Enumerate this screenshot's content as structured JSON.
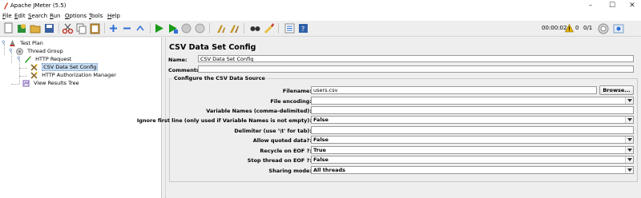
{
  "window": {
    "title": "Apache JMeter (5.5)",
    "minimize": "–",
    "maximize": "☐",
    "close": "✕"
  },
  "menu": [
    {
      "label": "File",
      "key": "F",
      "rest": "ile"
    },
    {
      "label": "Edit",
      "key": "E",
      "rest": "dit"
    },
    {
      "label": "Search",
      "key": "S",
      "rest": "earch"
    },
    {
      "label": "Run",
      "key": "R",
      "rest": "un"
    },
    {
      "label": "Options",
      "key": "O",
      "rest": "ptions"
    },
    {
      "label": "Tools",
      "key": "T",
      "rest": "ools"
    },
    {
      "label": "Help",
      "key": "H",
      "rest": "elp"
    }
  ],
  "toolbar": {
    "icons": [
      "new-icon",
      "templates-icon",
      "open-icon",
      "save-icon",
      "cut-icon",
      "copy-icon",
      "paste-icon",
      "expand-icon",
      "collapse-icon",
      "toggle-icon",
      "start-icon",
      "start-no-pauses-icon",
      "stop-icon",
      "shutdown-icon",
      "clear-icon",
      "clear-all-icon",
      "search-icon",
      "reset-search-icon",
      "function-helper-icon",
      "help-icon"
    ],
    "timer": "00:00:02",
    "warnings": "0",
    "threads": "0/1",
    "colors": {
      "run": "#1a9c1a",
      "accent": "#2f6fd6",
      "warning": "#e8b400"
    }
  },
  "tree": {
    "nodes": [
      {
        "label": "Test Plan",
        "icon": "test-plan-icon"
      },
      {
        "label": "Thread Group",
        "icon": "thread-group-icon"
      },
      {
        "label": "HTTP Request",
        "icon": "http-request-icon"
      },
      {
        "label": "CSV Data Set Config",
        "icon": "csv-config-icon"
      },
      {
        "label": "HTTP Authorization Manager",
        "icon": "auth-manager-icon"
      },
      {
        "label": "View Results Tree",
        "icon": "results-tree-icon"
      }
    ],
    "selected": "CSV Data Set Config"
  },
  "panel": {
    "title": "CSV Data Set Config",
    "name_label": "Name:",
    "name_value": "CSV Data Set Config",
    "comments_label": "Comments:",
    "comments_value": "",
    "group_title": "Configure the CSV Data Source",
    "filename_label": "Filename:",
    "filename_value": "users.csv",
    "browse_label": "Browse...",
    "encoding_label": "File encoding:",
    "encoding_value": "",
    "varnames_label": "Variable Names (comma-delimited):",
    "varnames_value": "",
    "ignore_label": "Ignore first line (only used if Variable Names is not empty):",
    "ignore_value": "False",
    "delimiter_label": "Delimiter (use '\\t' for tab):",
    "delimiter_value": "",
    "quoted_label": "Allow quoted data?:",
    "quoted_value": "False",
    "recycle_label": "Recycle on EOF ?:",
    "recycle_value": "True",
    "stop_label": "Stop thread on EOF ?:",
    "stop_value": "False",
    "sharing_label": "Sharing mode:",
    "sharing_value": "All threads"
  }
}
